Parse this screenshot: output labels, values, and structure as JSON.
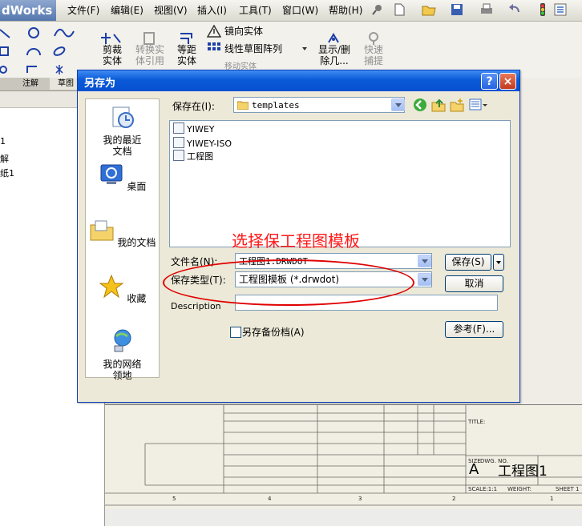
{
  "app": {
    "logo_text": "dWorks"
  },
  "menu": [
    {
      "label": "文件(F)"
    },
    {
      "label": "编辑(E)"
    },
    {
      "label": "视图(V)"
    },
    {
      "label": "插入(I)"
    },
    {
      "label": "工具(T)"
    },
    {
      "label": "窗口(W)"
    },
    {
      "label": "帮助(H)"
    }
  ],
  "ribbon": {
    "trim": "剪裁实体",
    "convert": "转换实体引用",
    "offset": "等距实体",
    "mirror": "镜向实体",
    "linear_pattern": "线性草图阵列",
    "move": "移动实体",
    "show_delete": "显示/删除几...",
    "quick_snap": "快速捕提"
  },
  "tabs": {
    "annotate": "注解",
    "sketch": "草图"
  },
  "tree": {
    "items": [
      "1",
      "解",
      "纸1"
    ]
  },
  "dialog": {
    "title": "另存为",
    "help_symbol": "?",
    "close_symbol": "×",
    "save_in_label": "保存在(I):",
    "save_in_value": "templates",
    "files": [
      {
        "name": "YIWEY"
      },
      {
        "name": "YIWEY-ISO"
      },
      {
        "name": "工程图"
      }
    ],
    "places": [
      {
        "label": "我的最近文档",
        "icon": "recent-documents-icon"
      },
      {
        "label": "桌面",
        "icon": "desktop-icon"
      },
      {
        "label": "我的文档",
        "icon": "my-documents-icon"
      },
      {
        "label": "收藏",
        "icon": "favorites-star-icon"
      },
      {
        "label": "我的网络领地",
        "icon": "network-places-icon"
      }
    ],
    "filename_label": "文件名(N):",
    "filename_value": "工程图1.DRWDOT",
    "filetype_label": "保存类型(T):",
    "filetype_value": "工程图模板 (*.drwdot)",
    "description_label": "Description",
    "description_value": "",
    "save_copy_label": "另存备份档(A)",
    "save_button": "保存(S)",
    "cancel_button": "取消",
    "references_button": "参考(F)..."
  },
  "annotation": {
    "text": "选择保工程图模板"
  },
  "title_block": {
    "sheet_name": "工程图1",
    "size_letter": "A",
    "size_label": "SIZE",
    "dwg_label": "DWG. NO.",
    "scale_label": "SCALE:1:1",
    "weight_label": "WEIGHT:",
    "sheet_label": "SHEET 1",
    "title_label": "TITLE:",
    "zone_numbers": [
      "5",
      "4",
      "3",
      "2",
      "1"
    ]
  }
}
